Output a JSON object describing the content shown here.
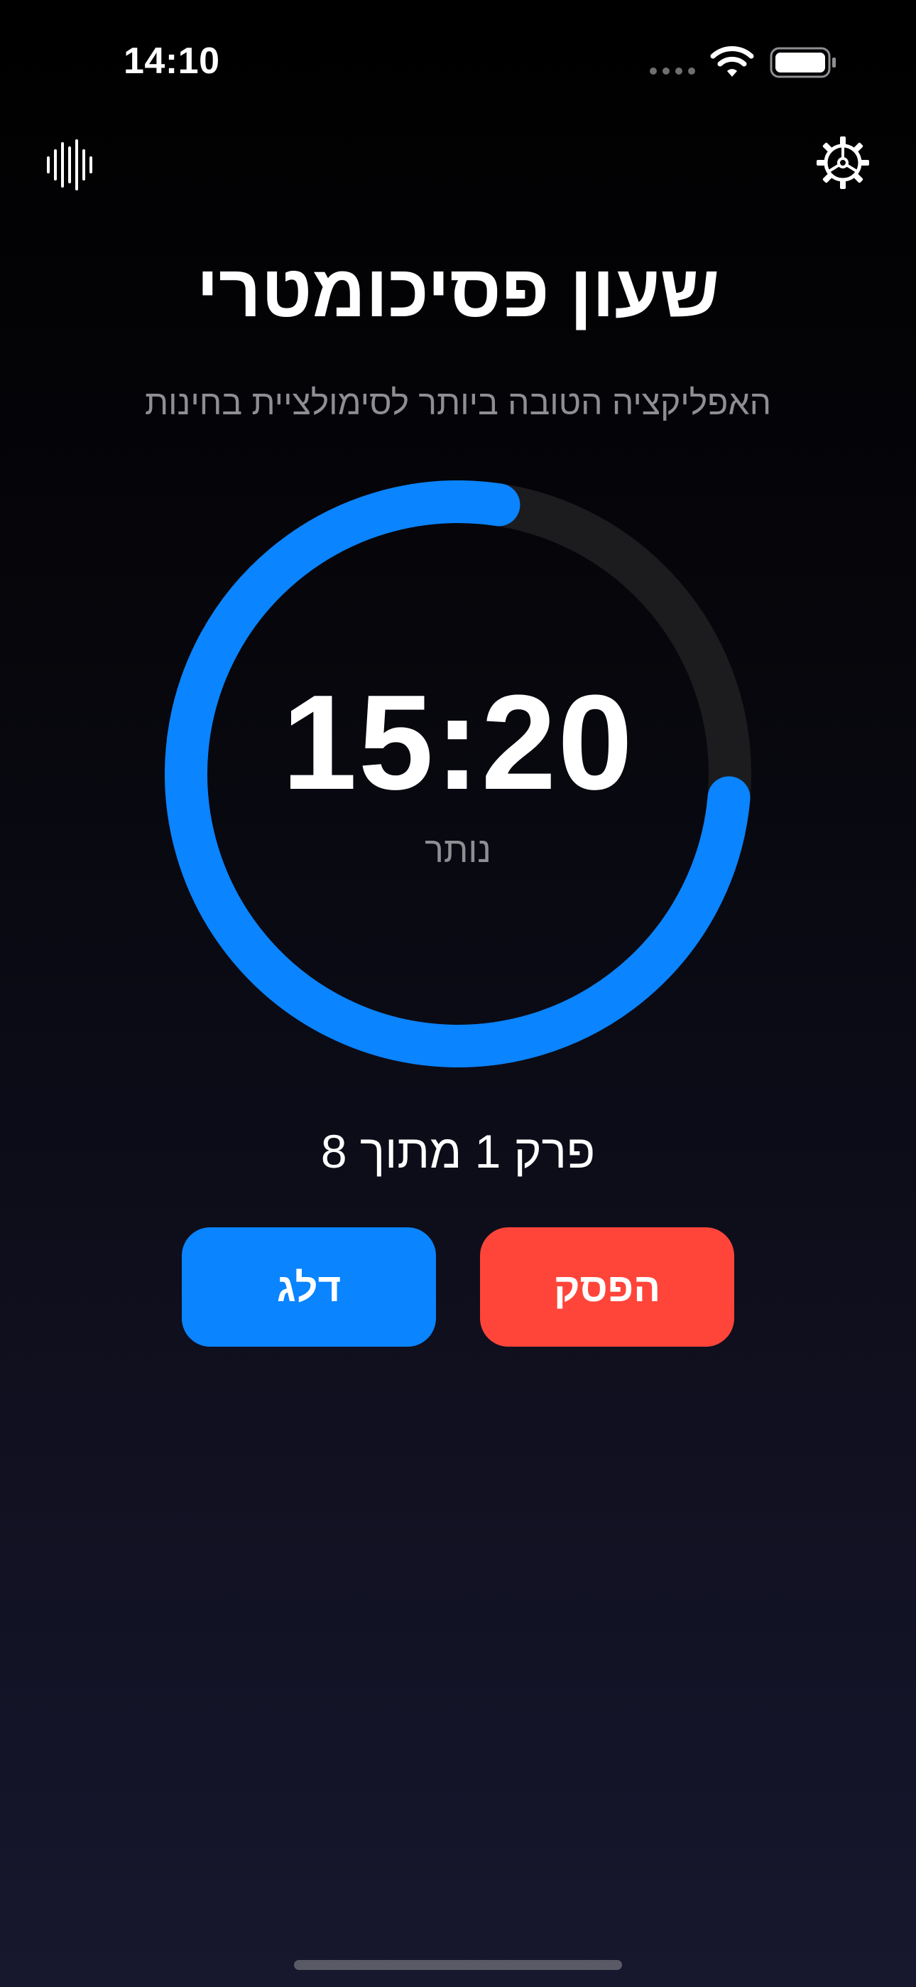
{
  "status_bar": {
    "time": "14:10",
    "icons": [
      "signal-dots-icon",
      "wifi-icon",
      "battery-icon"
    ]
  },
  "toolbar": {
    "left_icon": "waveform-icon",
    "right_icon": "gear-icon"
  },
  "header": {
    "title": "שעון פסיכומטרי",
    "subtitle": "האפליקציה הטובה ביותר לסימולציית בחינות"
  },
  "timer": {
    "value": "15:20",
    "caption": "נותר",
    "progress_fraction": 0.76,
    "progress_color": "#0a84ff",
    "track_color": "#1c1c1f"
  },
  "section": {
    "label": "פרק 1 מתוך 8"
  },
  "buttons": {
    "skip": {
      "label": "דלג",
      "color": "#0a84ff"
    },
    "stop": {
      "label": "הפסק",
      "color": "#ff453a"
    }
  }
}
